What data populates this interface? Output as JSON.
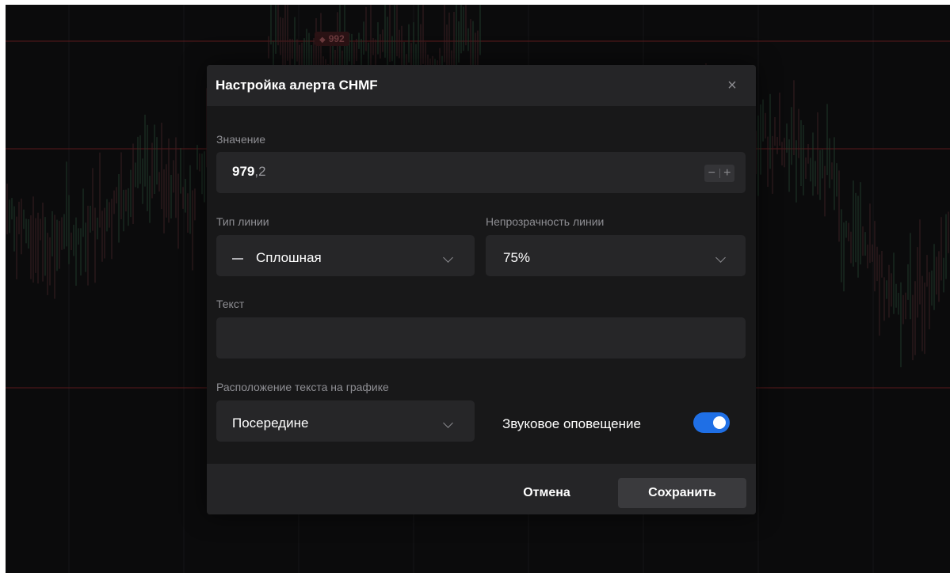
{
  "chart": {
    "price_flag": "992"
  },
  "modal": {
    "title": "Настройка алерта CHMF",
    "close": "×",
    "value": {
      "label": "Значение",
      "integer": "979",
      "fraction": ",2",
      "decrement": "−",
      "increment": "+"
    },
    "line_type": {
      "label": "Тип линии",
      "selected": "Сплошная"
    },
    "line_opacity": {
      "label": "Непрозрачность линии",
      "selected": "75%"
    },
    "text": {
      "label": "Текст",
      "value": ""
    },
    "text_position": {
      "label": "Расположение текста на графике",
      "selected": "Посередине"
    },
    "sound_alert": {
      "label": "Звуковое оповещение",
      "enabled": true
    },
    "footer": {
      "cancel_label": "Отмена",
      "save_label": "Сохранить"
    }
  },
  "colors": {
    "accent": "#1f6fe5",
    "modal_bg": "#181819",
    "header_bg": "#252527",
    "field_bg": "#262628",
    "level_line": "#5a1a1c"
  },
  "icons": {
    "close": "close-icon",
    "line_style": "solid-line-icon",
    "chevron": "chevron-down-icon",
    "flag": "flag-icon"
  }
}
